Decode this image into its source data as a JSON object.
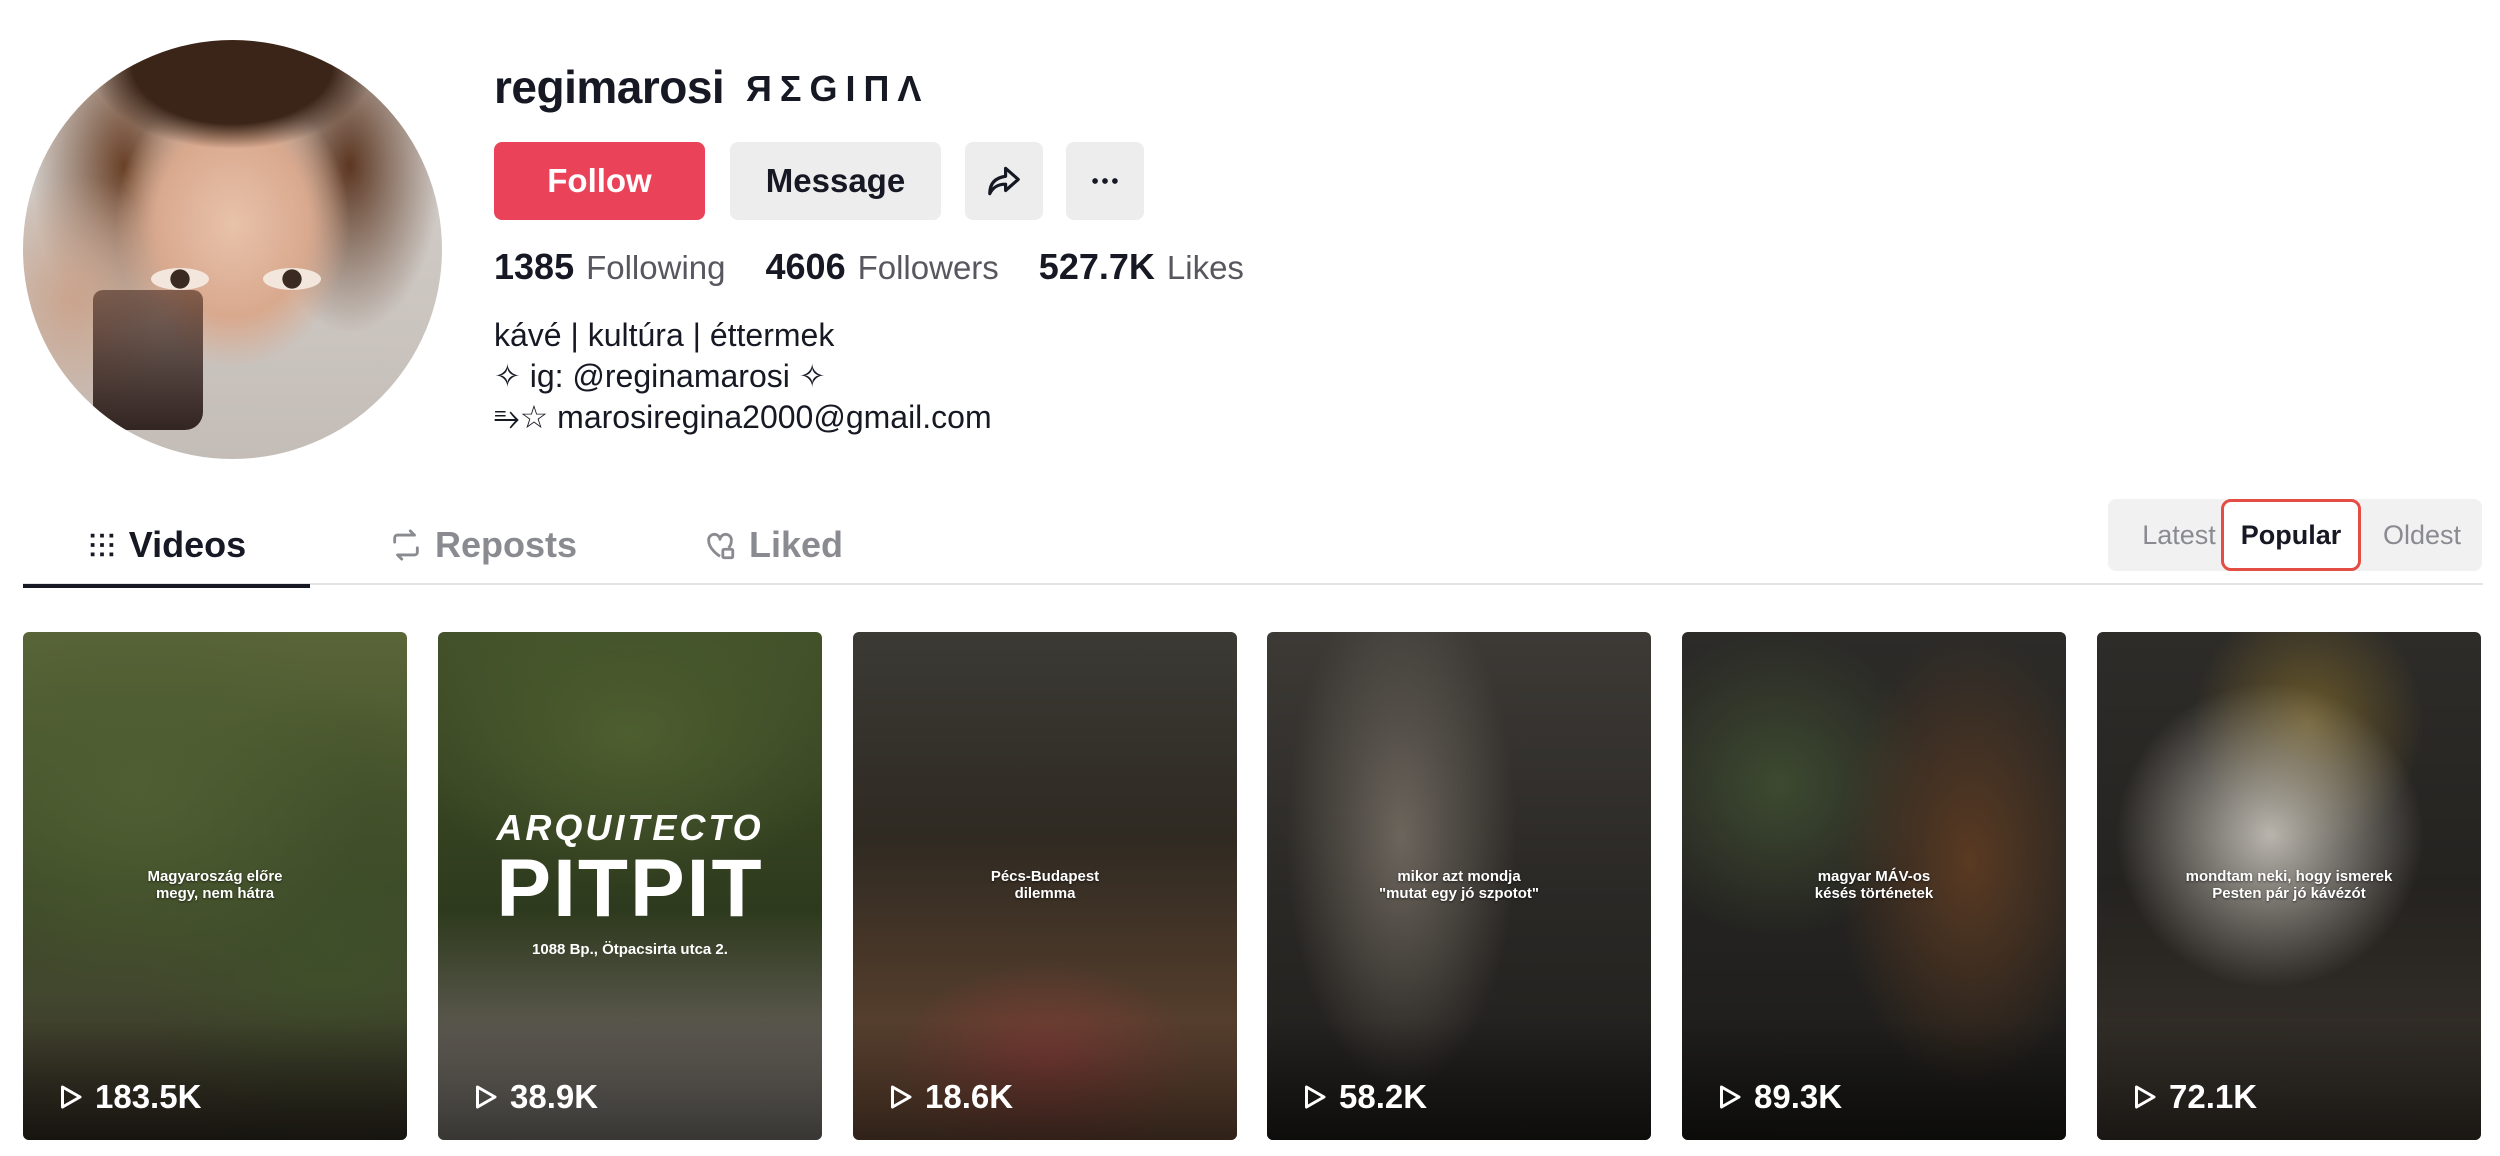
{
  "profile": {
    "username": "regimarosi",
    "nickname": "ЯΣGIПΛ",
    "follow_label": "Follow",
    "message_label": "Message",
    "stats": [
      {
        "num": "1385",
        "label": "Following"
      },
      {
        "num": "4606",
        "label": "Followers"
      },
      {
        "num": "527.7K",
        "label": "Likes"
      }
    ],
    "bio": [
      "kávé | kultúra | éttermek",
      "✧ ig: @reginamarosi ✧",
      "⥱☆ marosiregina2000@gmail.com"
    ]
  },
  "tabs": {
    "videos": "Videos",
    "reposts": "Reposts",
    "liked": "Liked"
  },
  "sort": {
    "latest": "Latest",
    "popular": "Popular",
    "oldest": "Oldest",
    "selected": "Popular"
  },
  "videos": [
    {
      "caption": "Magyaroszág előre\nmegy, nem hátra",
      "views": "183.5K"
    },
    {
      "caption": "",
      "logo_line1": "ARQUITECTO",
      "logo_line2": "PITPIT",
      "logo_line3": "1088 Bp., Ötpacsirta utca 2.",
      "views": "38.9K"
    },
    {
      "caption": "Pécs-Budapest\ndilemma",
      "views": "18.6K"
    },
    {
      "caption": "mikor azt mondja\n\"mutat egy jó szpotot\"",
      "views": "58.2K"
    },
    {
      "caption": "magyar MÁV-os\nkésés történetek",
      "views": "89.3K"
    },
    {
      "caption": "mondtam neki, hogy ismerek\nPesten pár jó kávézót",
      "views": "72.1K"
    }
  ],
  "colors": {
    "follow": "#ea4359",
    "sort_highlight": "#e34d43"
  }
}
